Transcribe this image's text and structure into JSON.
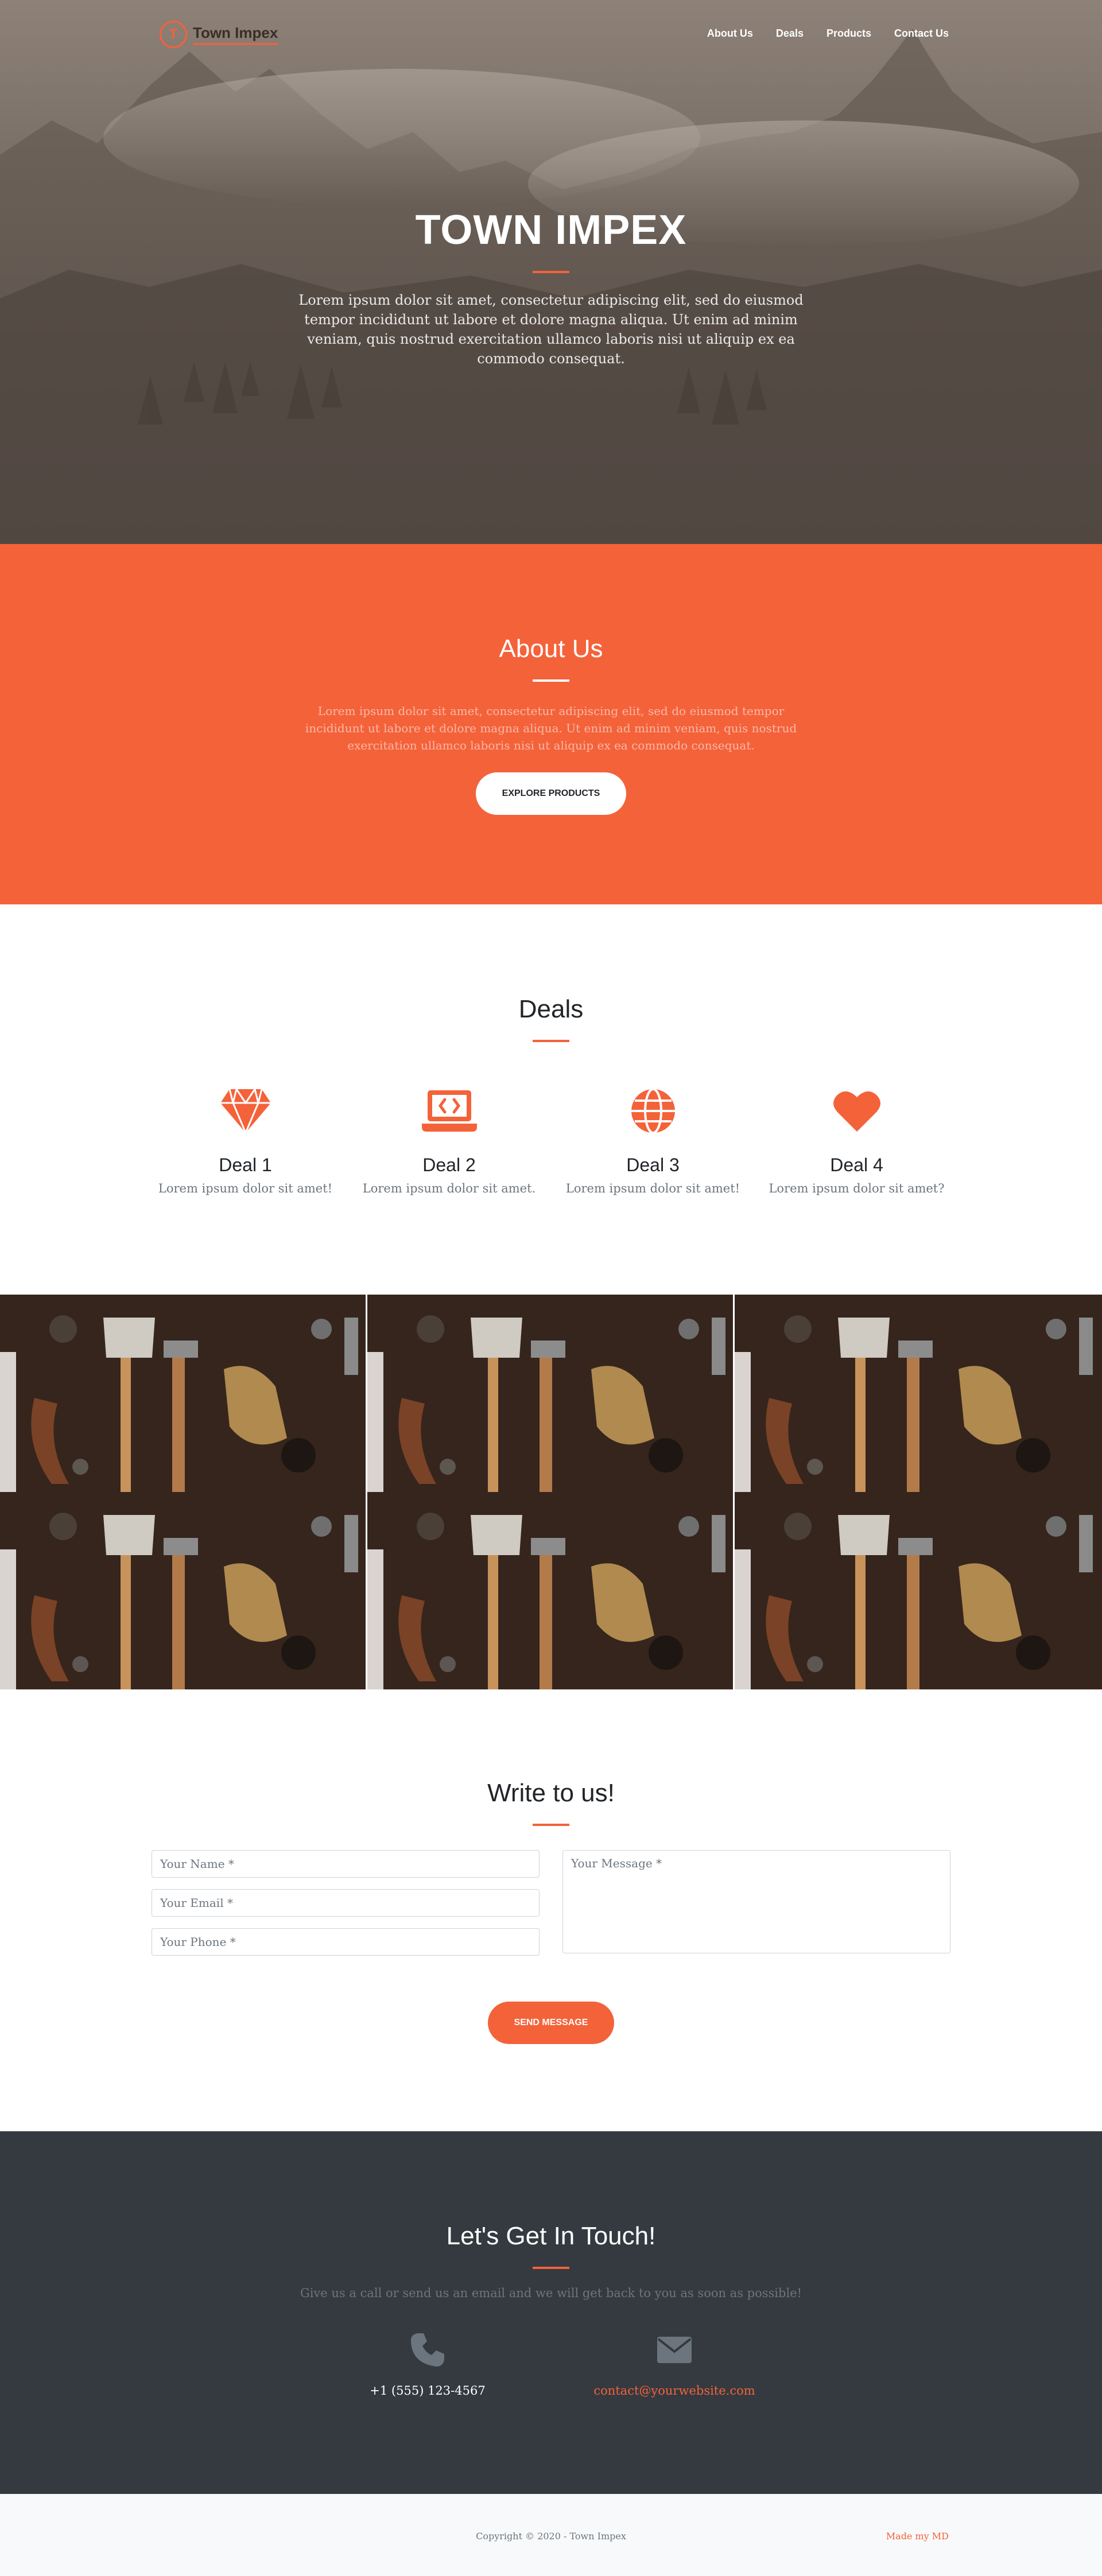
{
  "brand": {
    "logo_letter": "T",
    "name": "Town Impex"
  },
  "nav": {
    "items": [
      "About Us",
      "Deals",
      "Products",
      "Contact Us"
    ]
  },
  "hero": {
    "title": "TOWN IMPEX",
    "text": "Lorem ipsum dolor sit amet, consectetur adipiscing elit, sed do eiusmod tempor incididunt ut labore et dolore magna aliqua. Ut enim ad minim veniam, quis nostrud exercitation ullamco laboris nisi ut aliquip ex ea commodo consequat."
  },
  "about": {
    "title": "About Us",
    "text": "Lorem ipsum dolor sit amet, consectetur adipiscing elit, sed do eiusmod tempor incididunt ut labore et dolore magna aliqua. Ut enim ad minim veniam, quis nostrud exercitation ullamco laboris nisi ut aliquip ex ea commodo consequat.",
    "button": "Explore Products"
  },
  "deals": {
    "title": "Deals",
    "items": [
      {
        "icon": "gem-icon",
        "name": "Deal 1",
        "text": "Lorem ipsum dolor sit amet!"
      },
      {
        "icon": "laptop-code-icon",
        "name": "Deal 2",
        "text": "Lorem ipsum dolor sit amet."
      },
      {
        "icon": "globe-icon",
        "name": "Deal 3",
        "text": "Lorem ipsum dolor sit amet!"
      },
      {
        "icon": "heart-icon",
        "name": "Deal 4",
        "text": "Lorem ipsum dolor sit amet?"
      }
    ]
  },
  "contact_form": {
    "title": "Write to us!",
    "name_placeholder": "Your Name *",
    "email_placeholder": "Your Email *",
    "phone_placeholder": "Your Phone *",
    "message_placeholder": "Your Message *",
    "button": "Send Message"
  },
  "touch": {
    "title": "Let's Get In Touch!",
    "text": "Give us a call or send us an email and we will get back to you as soon as possible!",
    "phone": "+1 (555) 123-4567",
    "email": "contact@yourwebsite.com"
  },
  "footer": {
    "copyright": "Copyright © 2020 - Town Impex",
    "made_by": "Made my MD"
  },
  "colors": {
    "accent": "#f4623a",
    "dark": "#343a40",
    "muted": "#6c757d"
  }
}
